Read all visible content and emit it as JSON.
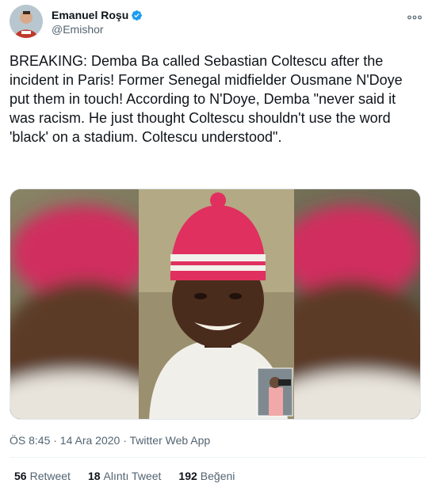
{
  "author": {
    "name": "Emanuel Roşu",
    "handle": "@Emishor",
    "verified_color": "#1d9bf0"
  },
  "more_icon": "more-horizontal-icon",
  "tweet": {
    "text": "BREAKING: Demba Ba called Sebastian Coltescu after the incident in Paris! Former Senegal midfielder Ousmane N'Doye put them in touch! According to N'Doye, Demba \"never said it was racism. He just thought Coltescu shouldn't use the word 'black' on a stadium. Coltescu understood\"."
  },
  "timestamp": "ÖS 8:45 · 14 Ara 2020 · Twitter Web App",
  "stats": [
    {
      "count": "56",
      "label": "Retweet"
    },
    {
      "count": "18",
      "label": "Alıntı Tweet"
    },
    {
      "count": "192",
      "label": "Beğeni"
    }
  ]
}
